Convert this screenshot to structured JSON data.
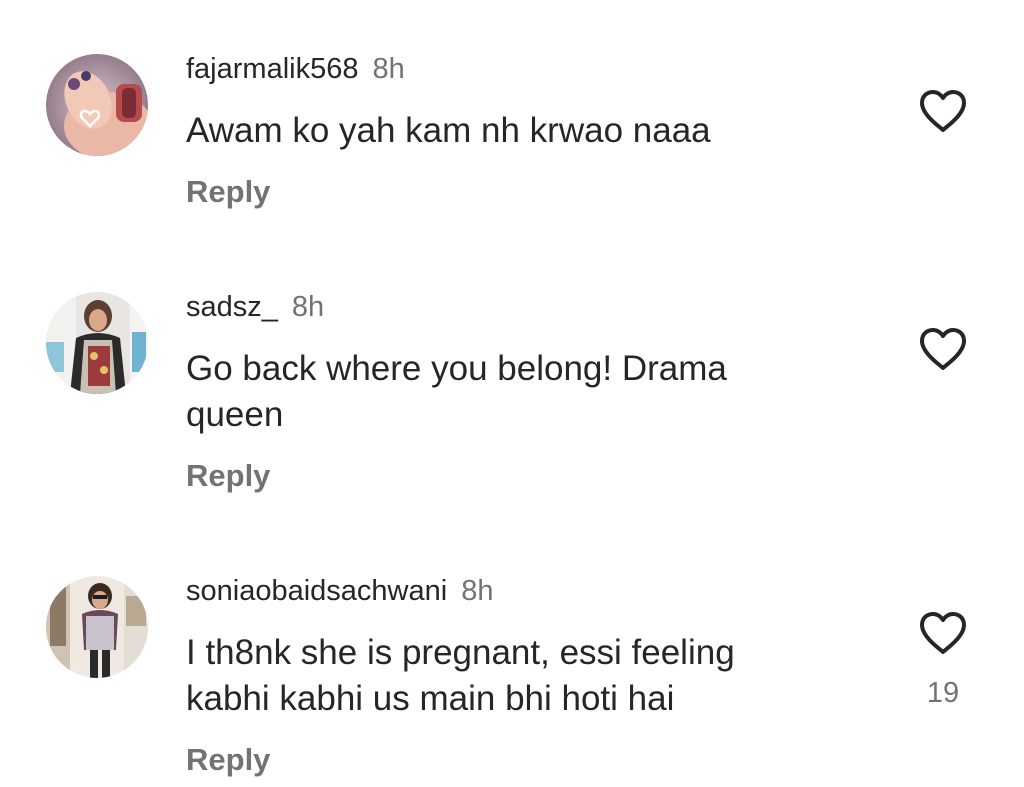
{
  "comments": [
    {
      "username": "fajarmalik568",
      "time": "8h",
      "text": "Awam ko yah kam nh krwao naaa",
      "reply_label": "Reply",
      "like_count": ""
    },
    {
      "username": "sadsz_",
      "time": "8h",
      "text": "Go back where you belong! Drama queen",
      "reply_label": "Reply",
      "like_count": ""
    },
    {
      "username": "soniaobaidsachwani",
      "time": "8h",
      "text": "I th8nk she is pregnant, essi feeling kabhi kabhi us main bhi hoti hai",
      "reply_label": "Reply",
      "like_count": "19"
    }
  ],
  "icons": {
    "like": "heart-outline-icon",
    "avatar_badge": "heart-icon"
  },
  "colors": {
    "text": "#262626",
    "secondary": "#737373",
    "background": "#ffffff"
  }
}
